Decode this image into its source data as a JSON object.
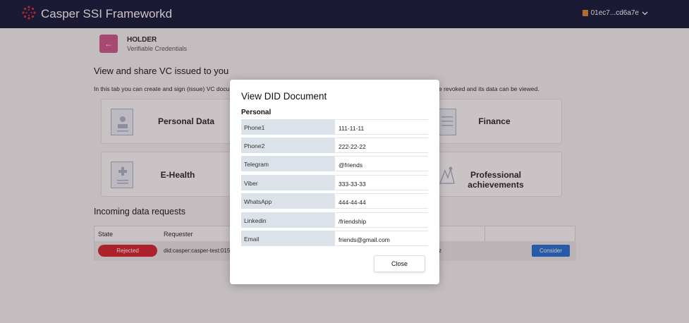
{
  "header": {
    "app_title": "Casper SSI Frameworkd",
    "account_label": "01ec7...cd6a7e",
    "brand_color": "#0f1535",
    "account_icon": "wallet-icon",
    "logo_icon": "casper-logo-icon",
    "dropdown_icon": "chevron-down-icon"
  },
  "holder": {
    "back_icon": "arrow-left-icon",
    "role": "HOLDER",
    "subtitle": "Verifiable Credentials"
  },
  "main": {
    "heading": "View and share VC issued to you",
    "description": "In this tab you can create and sign (issue) VC docu",
    "description_right": "e revoked and its data can be viewed.",
    "cards": [
      {
        "label": "Personal Data",
        "icon": "id-card-icon"
      },
      {
        "label": "Finance",
        "icon": "finance-document-icon"
      },
      {
        "label": "E-Health",
        "icon": "health-record-icon"
      },
      {
        "label": "Professional achievements",
        "icon": "achievements-icon"
      }
    ]
  },
  "requests": {
    "heading": "Incoming data requests",
    "columns": [
      "State",
      "Requester"
    ],
    "rows": [
      {
        "state": "Rejected",
        "requester": "did:casper:casper-test:015a",
        "tail": "z",
        "action": "Consider"
      }
    ]
  },
  "modal": {
    "title": "View DID Document",
    "section": "Personal",
    "fields": [
      {
        "key": "Phone1",
        "value": "111-11-11"
      },
      {
        "key": "Phone2",
        "value": "222-22-22"
      },
      {
        "key": "Telegram",
        "value": "@friends"
      },
      {
        "key": "Viber",
        "value": "333-33-33"
      },
      {
        "key": "WhatsApp",
        "value": "444-44-44"
      },
      {
        "key": "Linkedin",
        "value": "/friendship"
      },
      {
        "key": "Email",
        "value": "friends@gmail.com"
      }
    ],
    "close_label": "Close"
  }
}
